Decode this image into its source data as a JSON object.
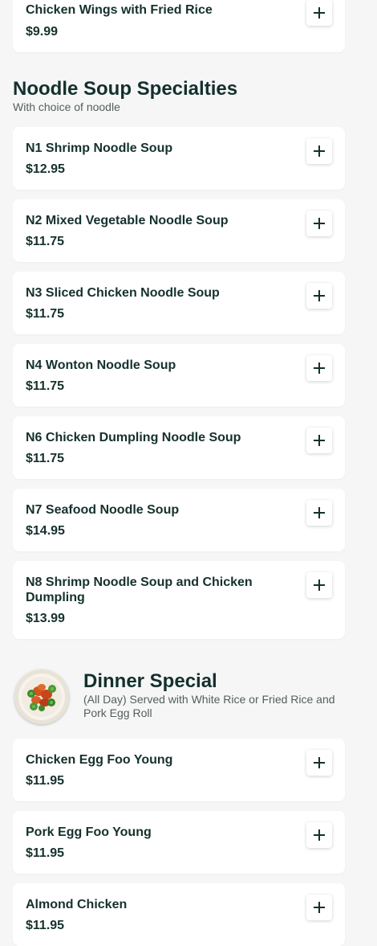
{
  "sections": {
    "noodle": {
      "title": "Noodle Soup Specialties",
      "subtitle": "With choice of noodle"
    },
    "dinner": {
      "title": "Dinner Special",
      "subtitle": "(All Day) Served with White Rice or Fried Rice and Pork Egg Roll",
      "image_icon": "dish-photo"
    }
  },
  "items": [
    {
      "name": "Chicken Wings with Fried Rice",
      "price": "$9.99"
    },
    {
      "name": "N1 Shrimp Noodle Soup",
      "price": "$12.95"
    },
    {
      "name": "N2 Mixed Vegetable Noodle Soup",
      "price": "$11.75"
    },
    {
      "name": "N3 Sliced Chicken Noodle Soup",
      "price": "$11.75"
    },
    {
      "name": "N4 Wonton Noodle Soup",
      "price": "$11.75"
    },
    {
      "name": "N6 Chicken Dumpling Noodle Soup",
      "price": "$11.75"
    },
    {
      "name": "N7 Seafood Noodle Soup",
      "price": "$14.95"
    },
    {
      "name": "N8 Shrimp Noodle Soup and Chicken Dumpling",
      "price": "$13.99"
    },
    {
      "name": "Chicken Egg Foo Young",
      "price": "$11.95"
    },
    {
      "name": "Pork Egg Foo Young",
      "price": "$11.95"
    },
    {
      "name": "Almond Chicken",
      "price": "$11.95"
    }
  ],
  "icons": {
    "add": "plus-icon"
  },
  "colors": {
    "text": "#13302c",
    "background": "#f6f6f7",
    "card": "#ffffff"
  }
}
